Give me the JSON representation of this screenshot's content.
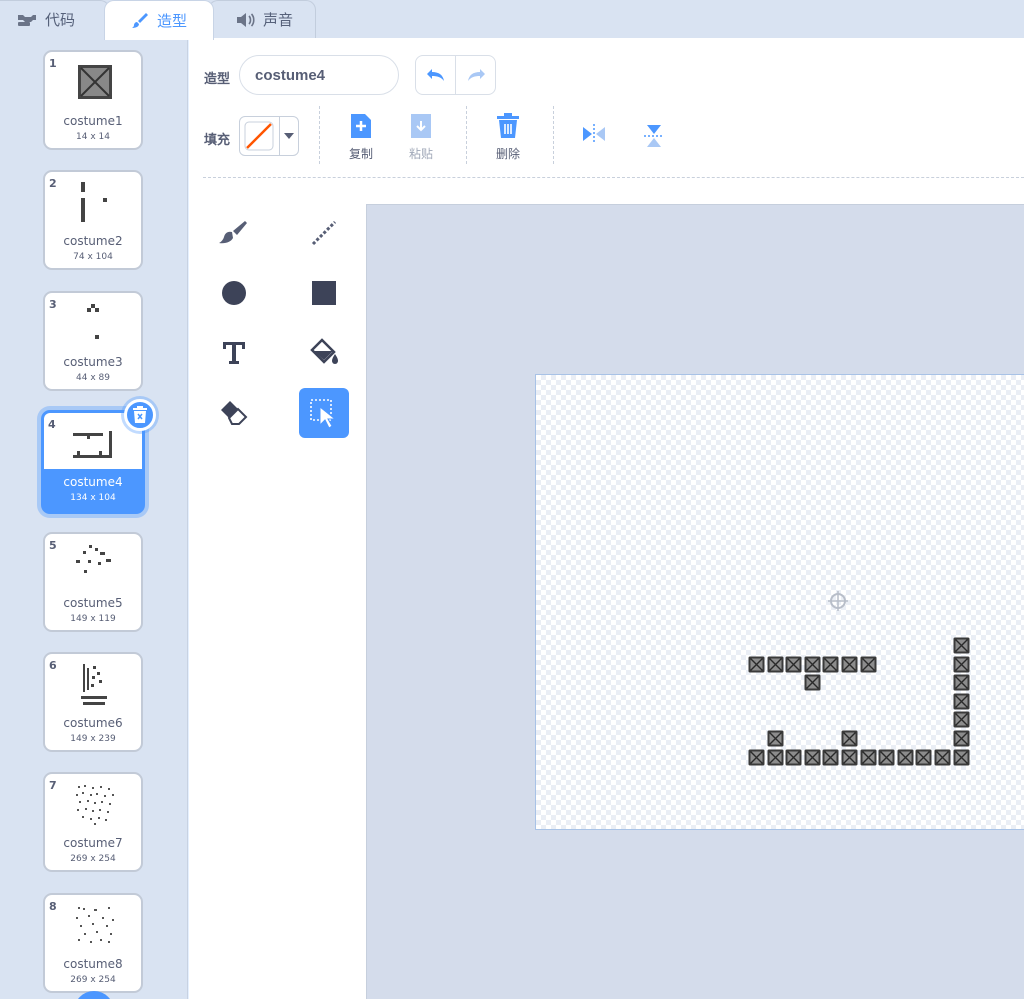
{
  "tabs": [
    {
      "label": "代码",
      "icon": "code-blocks-icon"
    },
    {
      "label": "造型",
      "icon": "paintbrush-icon",
      "active": true
    },
    {
      "label": "声音",
      "icon": "speaker-icon"
    }
  ],
  "costumes": [
    {
      "num": "1",
      "name": "costume1",
      "size": "14 x 14"
    },
    {
      "num": "2",
      "name": "costume2",
      "size": "74 x 104"
    },
    {
      "num": "3",
      "name": "costume3",
      "size": "44 x 89"
    },
    {
      "num": "4",
      "name": "costume4",
      "size": "134 x 104",
      "selected": true
    },
    {
      "num": "5",
      "name": "costume5",
      "size": "149 x 119"
    },
    {
      "num": "6",
      "name": "costume6",
      "size": "149 x 239"
    },
    {
      "num": "7",
      "name": "costume7",
      "size": "269 x 254"
    },
    {
      "num": "8",
      "name": "costume8",
      "size": "269 x 254"
    }
  ],
  "editor": {
    "costume_label": "造型",
    "costume_name": "costume4",
    "fill_label": "填充",
    "fill_color": "#ff5500",
    "actions": {
      "copy": "复制",
      "paste": "粘贴",
      "delete": "删除"
    }
  },
  "tools": [
    "brush-tool",
    "line-tool",
    "circle-tool",
    "rectangle-tool",
    "text-tool",
    "fill-tool",
    "eraser-tool",
    "select-tool"
  ],
  "colors": {
    "accent": "#4c97ff",
    "sidebar_bg": "#d9e3f2",
    "canvas_bg": "#d4dceb",
    "block_dark": "#555555"
  }
}
